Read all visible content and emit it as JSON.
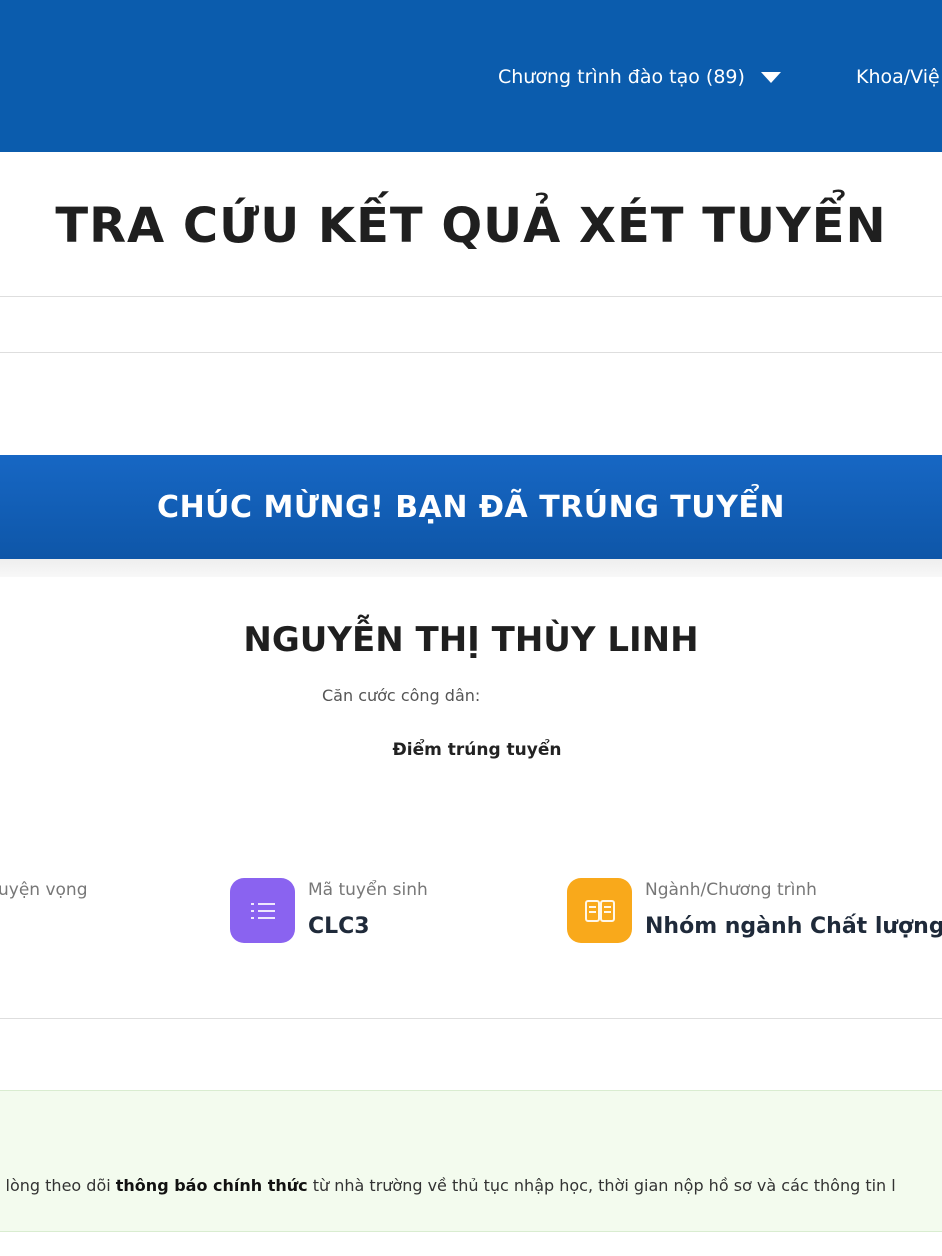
{
  "nav": {
    "programs": "Chương trình đào tạo (89)",
    "faculty": "Khoa/Việ"
  },
  "title": "TRA CỨU KẾT QUẢ XÉT TUYỂN",
  "banner": "CHÚC MỪNG! BẠN ĐÃ TRÚNG TUYỂN",
  "student": {
    "name": "NGUYỄN THỊ THÙY LINH",
    "id_label": "Căn cước công dân:",
    "score_label": "Điểm trúng tuyển"
  },
  "info": {
    "preference_label": "uyện vọng",
    "code_label": "Mã tuyển sinh",
    "code_value": "CLC3",
    "major_label": "Ngành/Chương trình",
    "major_value": "Nhóm ngành Chất lượng ca"
  },
  "notice": {
    "prefix": "i lòng theo dõi ",
    "bold": "thông báo chính thức",
    "suffix": " từ nhà trường về thủ tục nhập học, thời gian nộp hồ sơ và các thông tin l"
  },
  "colors": {
    "nav_bg": "#0b5cad",
    "banner_bg": "#1767c4",
    "icon_purple": "#8a63f0",
    "icon_orange": "#f9a91b",
    "notice_bg": "#f3fbee"
  },
  "icons": [
    "caret-down-icon",
    "list-icon",
    "book-icon"
  ]
}
